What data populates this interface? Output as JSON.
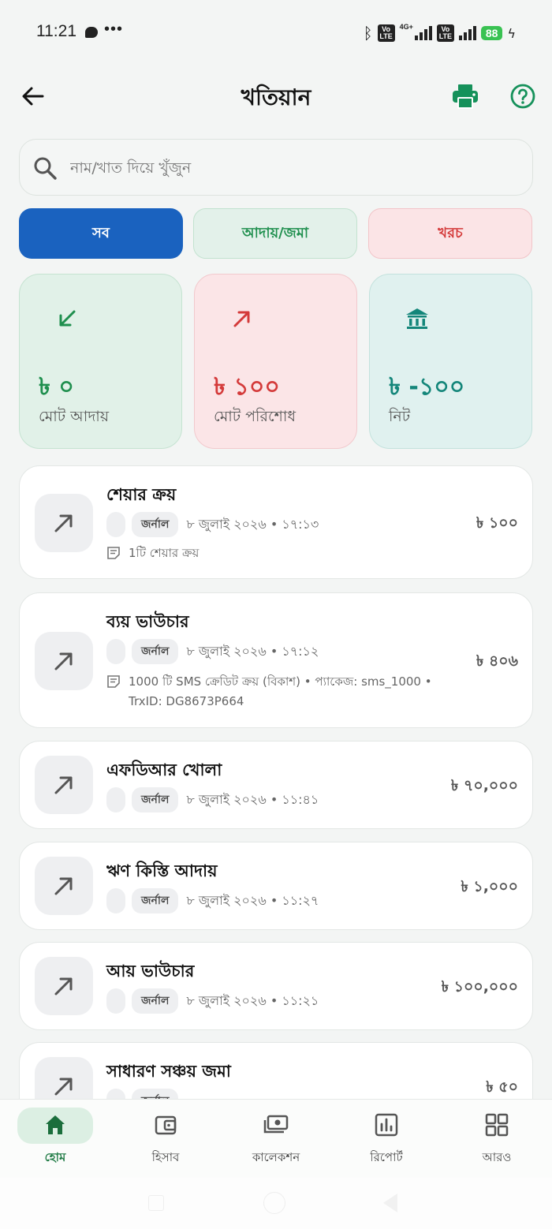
{
  "status_bar": {
    "time": "11:21",
    "network_label": "4G+",
    "volte_label": "Vo LTE",
    "battery": "88"
  },
  "header": {
    "title": "খতিয়ান"
  },
  "search": {
    "placeholder": "নাম/খাত দিয়ে খুঁজুন"
  },
  "tabs": [
    {
      "label": "সব",
      "active": true
    },
    {
      "label": "আদায়/জমা",
      "active": false
    },
    {
      "label": "খরচ",
      "active": false
    }
  ],
  "summary": {
    "income": {
      "amount": "৳ ০",
      "label": "মোট আদায়"
    },
    "expense": {
      "amount": "৳ ১০০",
      "label": "মোট পরিশোধ"
    },
    "net": {
      "amount": "৳ -১০০",
      "label": "নিট"
    }
  },
  "transactions": [
    {
      "title": "শেয়ার ক্রয়",
      "chip": "জর্নাল",
      "date": "৮ জুলাই ২০২৬ • ১৭:১৩",
      "note": "1টি শেয়ার ক্রয়",
      "amount": "৳ ১০০"
    },
    {
      "title": "ব্যয় ভাউচার",
      "chip": "জর্নাল",
      "date": "৮ জুলাই ২০২৬ • ১৭:১২",
      "note": "1000 টি SMS ক্রেডিট ক্রয় (বিকাশ) • প্যাকেজ: sms_1000 • TrxID: DG8673P664",
      "amount": "৳ ৪০৬"
    },
    {
      "title": "এফডিআর খোলা",
      "chip": "জর্নাল",
      "date": "৮ জুলাই ২০২৬ • ১১:৪১",
      "note": "",
      "amount": "৳ ৭০,০০০"
    },
    {
      "title": "ঋণ কিস্তি আদায়",
      "chip": "জর্নাল",
      "date": "৮ জুলাই ২০২৬ • ১১:২৭",
      "note": "",
      "amount": "৳ ১,০০০"
    },
    {
      "title": "আয় ভাউচার",
      "chip": "জর্নাল",
      "date": "৮ জুলাই ২০২৬ • ১১:২১",
      "note": "",
      "amount": "৳ ১০০,০০০"
    },
    {
      "title": "সাধারণ সঞ্চয় জমা",
      "chip": "জর্নাল",
      "date": "",
      "note": "",
      "amount": "৳ ৫০"
    }
  ],
  "bottom_nav": [
    {
      "label": "হোম",
      "icon": "home-icon",
      "active": true
    },
    {
      "label": "হিসাব",
      "icon": "wallet-icon",
      "active": false
    },
    {
      "label": "কালেকশন",
      "icon": "cash-icon",
      "active": false
    },
    {
      "label": "রিপোর্ট",
      "icon": "chart-icon",
      "active": false
    },
    {
      "label": "আরও",
      "icon": "grid-icon",
      "active": false
    }
  ],
  "colors": {
    "primary_blue": "#1a62bf",
    "green": "#1f8f4e",
    "red": "#d43a3a",
    "teal": "#14867a"
  }
}
